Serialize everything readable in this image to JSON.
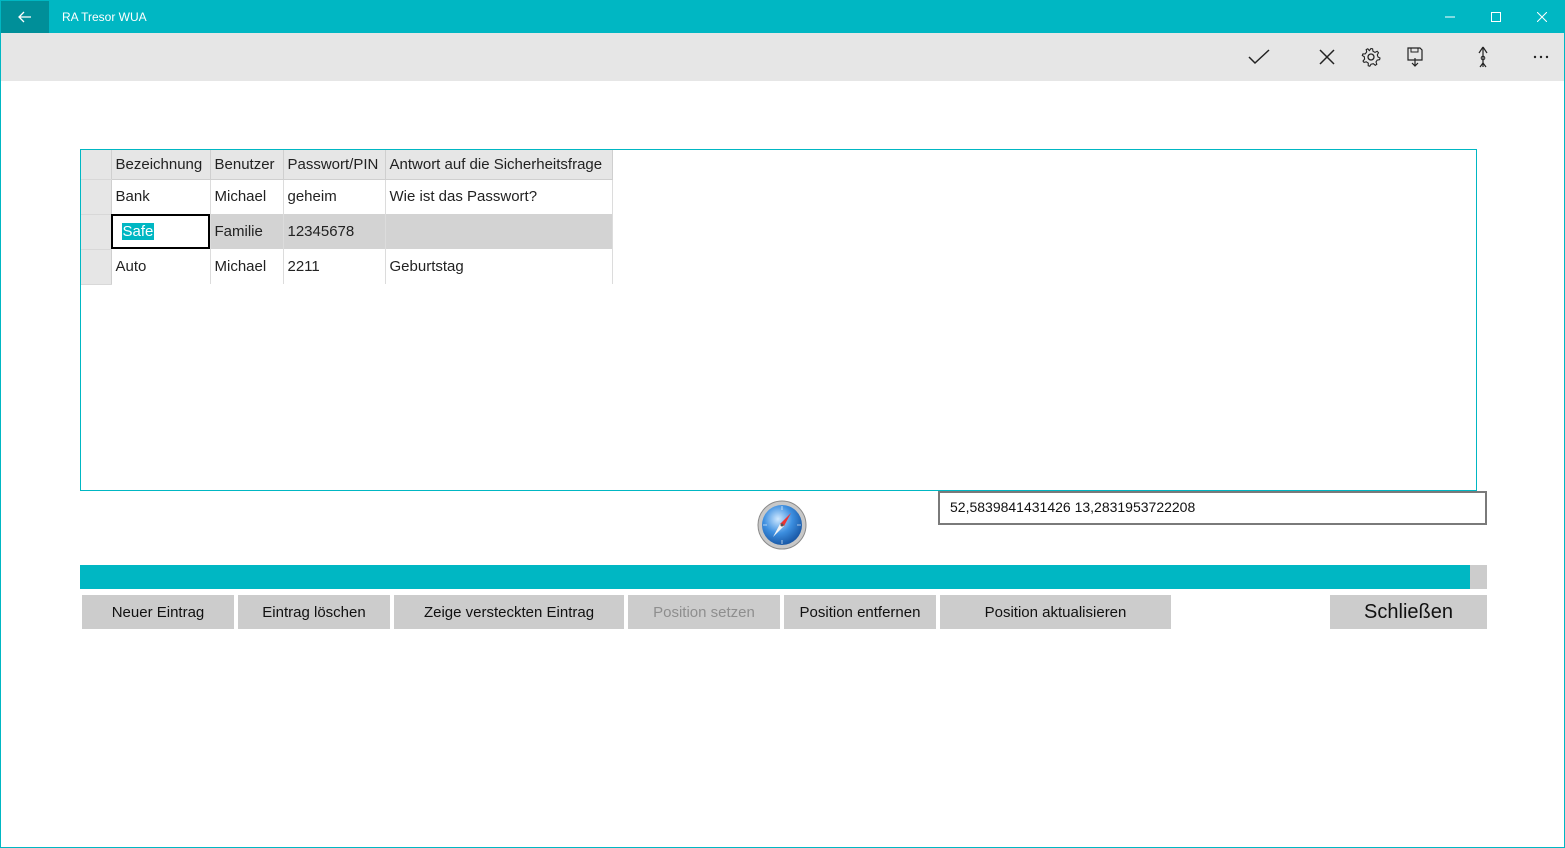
{
  "window": {
    "title": "RA Tresor WUA",
    "accent": "#00b7c3"
  },
  "commandbar": {
    "icons": [
      "checkmark-icon",
      "cancel-icon",
      "settings-icon",
      "save-icon",
      "location-arrow-icon",
      "more-icon"
    ]
  },
  "grid": {
    "columns": [
      "Bezeichnung",
      "Benutzer",
      "Passwort/PIN",
      "Antwort auf die Sicherheitsfrage"
    ],
    "rows": [
      [
        "Bank",
        "Michael",
        "geheim",
        "Wie ist das Passwort?"
      ],
      [
        "Safe",
        "Familie",
        "12345678",
        ""
      ],
      [
        "Auto",
        "Michael",
        "2211",
        "Geburtstag"
      ]
    ],
    "selected_row": 1
  },
  "coordinates": {
    "value": "52,5839841431426 13,2831953722208"
  },
  "progress": {
    "percent": 98.8
  },
  "buttons": {
    "new_entry": "Neuer Eintrag",
    "delete_entry": "Eintrag löschen",
    "show_hidden": "Zeige versteckten Eintrag",
    "set_position": "Position setzen",
    "remove_position": "Position entfernen",
    "update_position": "Position aktualisieren",
    "close": "Schließen"
  }
}
